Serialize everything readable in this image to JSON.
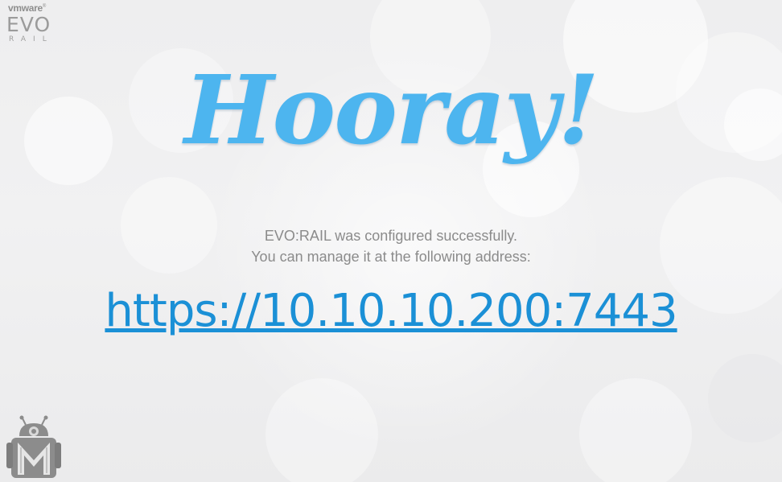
{
  "branding": {
    "vendor": "vmware",
    "product_line1": "EVO",
    "product_line2": "RAIL"
  },
  "headline": "Hooray!",
  "message": {
    "line1": "EVO:RAIL was configured successfully.",
    "line2": "You can manage it at the following address:"
  },
  "management_url": "https://10.10.10.200:7443",
  "colors": {
    "headline": "#4db5ef",
    "url": "#1b90d6",
    "message": "#8b8b8b",
    "background": "#ececed"
  },
  "icons": {
    "mascot": "robot-icon"
  }
}
